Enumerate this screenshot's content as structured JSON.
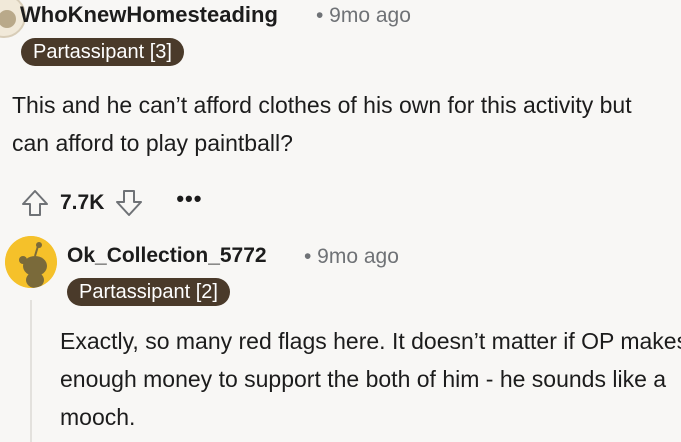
{
  "comments": [
    {
      "username": "WhoKnewHomesteading",
      "time": "• 9mo ago",
      "flair": "Partassipant [3]",
      "body": "This and he can’t afford clothes of his own for this activity but can afford to play paintball?",
      "score": "7.7K",
      "more_label": "•••"
    },
    {
      "username": "Ok_Collection_5772",
      "time": "• 9mo ago",
      "flair": "Partassipant [2]",
      "body": "Exactly, so many red flags here. It doesn’t matter if OP makes enough money to support the both of him - he sounds like a mooch."
    }
  ],
  "icons": {
    "upvote": "upvote-arrow-icon",
    "downvote": "downvote-arrow-icon",
    "avatar_default": "snoo-avatar-icon"
  },
  "colors": {
    "flair_bg": "#4a3a2a",
    "meta_gray": "#6f7276",
    "avatar_yellow": "#f5c12a"
  }
}
